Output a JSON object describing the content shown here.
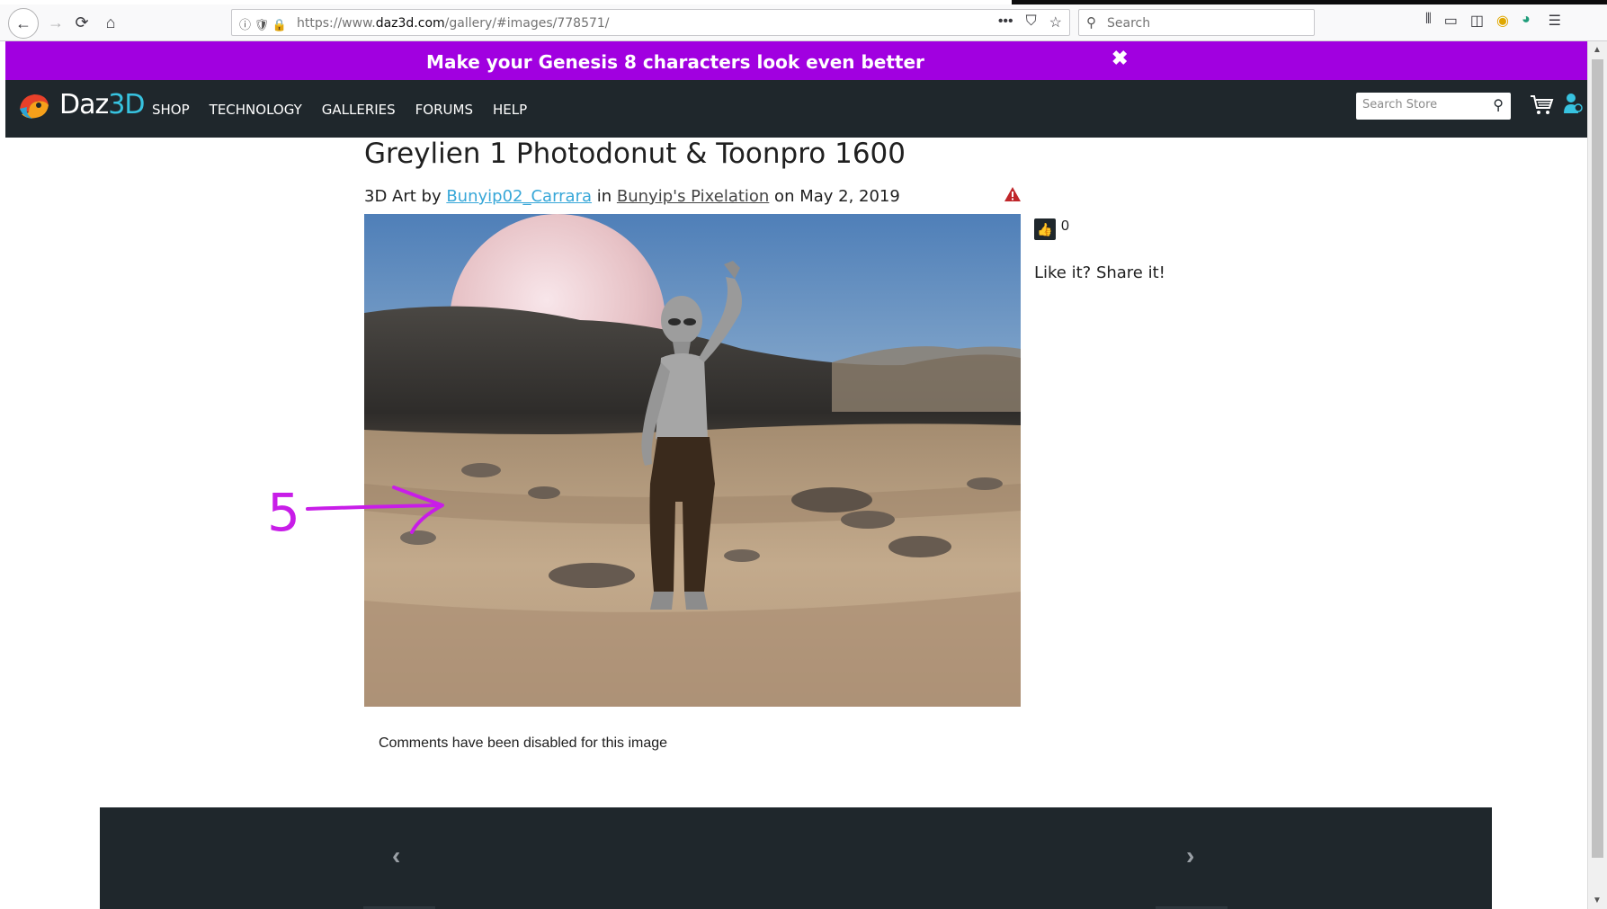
{
  "browser": {
    "url_prefix": "https://www.",
    "url_domain": "daz3d.com",
    "url_path": "/gallery/#images/778571/",
    "search_placeholder": "Search",
    "more_label": "•••"
  },
  "promo": {
    "text": "Make your Genesis 8 characters look even better",
    "close_glyph": "✖"
  },
  "site": {
    "logo_text_1": "Daz",
    "logo_text_2": "3D",
    "nav": [
      "SHOP",
      "TECHNOLOGY",
      "GALLERIES",
      "FORUMS",
      "HELP"
    ],
    "store_search_placeholder": "Search Store"
  },
  "artwork": {
    "title": "Greylien 1 Photodonut & Toonpro 1600",
    "byline_prefix": "3D Art by ",
    "artist": "Bunyip02_Carrara",
    "in_word": " in ",
    "gallery": "Bunyip's Pixelation",
    "date_text": " on May 2, 2019",
    "likes": "0",
    "share_text": "Like it? Share it!",
    "comments_text": "Comments have been disabled for this image"
  },
  "annotation": {
    "number": "5",
    "color": "#c81de8"
  },
  "colors": {
    "promo_bg": "#a100e0",
    "header_bg": "#1f272c",
    "link": "#37a7d8"
  }
}
